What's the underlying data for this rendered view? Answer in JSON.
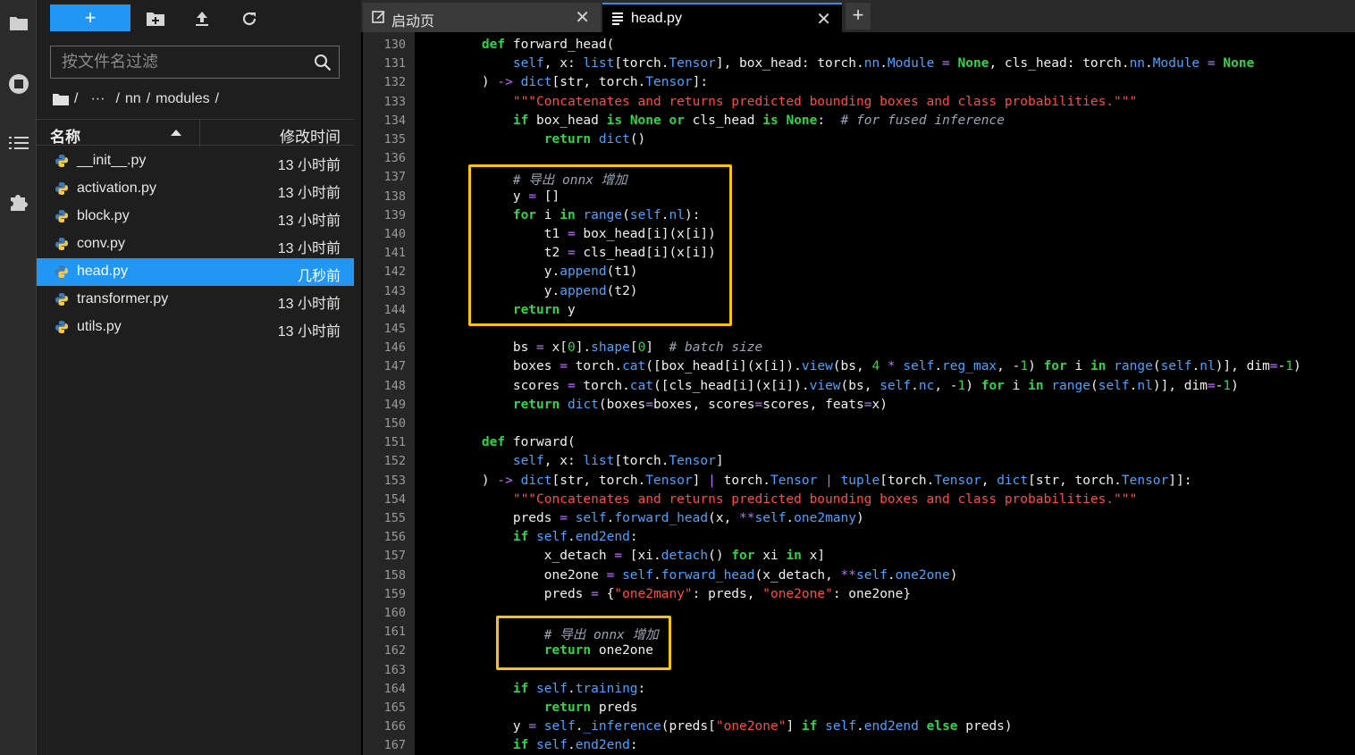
{
  "file_browser": {
    "new_button_label": "+",
    "filter_placeholder": "按文件名过滤",
    "breadcrumb": {
      "dots": "···",
      "seg1": "nn",
      "seg2": "modules",
      "sep": "/"
    },
    "columns": {
      "name": "名称",
      "modified": "修改时间"
    },
    "files": [
      {
        "name": "__init__.py",
        "modified": "13 小时前",
        "selected": false
      },
      {
        "name": "activation.py",
        "modified": "13 小时前",
        "selected": false
      },
      {
        "name": "block.py",
        "modified": "13 小时前",
        "selected": false
      },
      {
        "name": "conv.py",
        "modified": "13 小时前",
        "selected": false
      },
      {
        "name": "head.py",
        "modified": "几秒前",
        "selected": true
      },
      {
        "name": "transformer.py",
        "modified": "13 小时前",
        "selected": false
      },
      {
        "name": "utils.py",
        "modified": "13 小时前",
        "selected": false
      }
    ]
  },
  "tabs": [
    {
      "label": "启动页",
      "close": "✕"
    },
    {
      "label": "head.py",
      "close": "✕"
    }
  ],
  "tab_add_label": "+",
  "editor": {
    "line_numbers": [
      "130",
      "131",
      "132",
      "133",
      "134",
      "135",
      "136",
      "137",
      "138",
      "139",
      "140",
      "141",
      "142",
      "143",
      "144",
      "145",
      "146",
      "147",
      "148",
      "149",
      "150",
      "151",
      "152",
      "153",
      "154",
      "155",
      "156",
      "157",
      "158",
      "159",
      "160",
      "161",
      "162",
      "163",
      "164",
      "165",
      "166",
      "167"
    ],
    "lines": [
      "    def forward_head(",
      "        self, x: list[torch.Tensor], box_head: torch.nn.Module = None, cls_head: torch.nn.Module = None",
      "    ) -> dict[str, torch.Tensor]:",
      "        \"\"\"Concatenates and returns predicted bounding boxes and class probabilities.\"\"\"",
      "        if box_head is None or cls_head is None:  # for fused inference",
      "            return dict()",
      "",
      "        # 导出 onnx 增加",
      "        y = []",
      "        for i in range(self.nl):",
      "            t1 = box_head[i](x[i])",
      "            t2 = cls_head[i](x[i])",
      "            y.append(t1)",
      "            y.append(t2)",
      "        return y",
      "",
      "        bs = x[0].shape[0]  # batch size",
      "        boxes = torch.cat([box_head[i](x[i]).view(bs, 4 * self.reg_max, -1) for i in range(self.nl)], dim=-1)",
      "        scores = torch.cat([cls_head[i](x[i]).view(bs, self.nc, -1) for i in range(self.nl)], dim=-1)",
      "        return dict(boxes=boxes, scores=scores, feats=x)",
      "",
      "    def forward(",
      "        self, x: list[torch.Tensor]",
      "    ) -> dict[str, torch.Tensor] | torch.Tensor | tuple[torch.Tensor, dict[str, torch.Tensor]]:",
      "        \"\"\"Concatenates and returns predicted bounding boxes and class probabilities.\"\"\"",
      "        preds = self.forward_head(x, **self.one2many)",
      "        if self.end2end:",
      "            x_detach = [xi.detach() for xi in x]",
      "            one2one = self.forward_head(x_detach, **self.one2one)",
      "            preds = {\"one2many\": preds, \"one2one\": one2one}",
      "",
      "            # 导出 onnx 增加",
      "            return one2one",
      "",
      "        if self.training:",
      "            return preds",
      "        y = self._inference(preds[\"one2one\"] if self.end2end else preds)",
      "        if self.end2end:"
    ]
  },
  "colors": {
    "accent": "#2196f3",
    "highlight_box": "#ffc400",
    "keyword": "#2fd44a",
    "builtin": "#4aa3ff",
    "string": "#ff4a4a",
    "comment": "#9aa5b5"
  }
}
